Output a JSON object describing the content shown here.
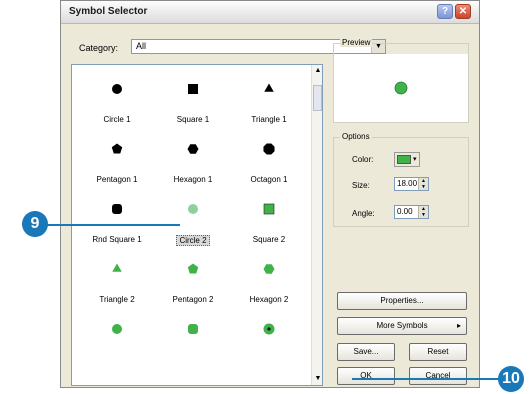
{
  "window": {
    "title": "Symbol Selector"
  },
  "title_buttons": {
    "help": "?",
    "close": "✕"
  },
  "category": {
    "label": "Category:",
    "value": "All"
  },
  "symbols": [
    {
      "label": "Circle 1",
      "shape": "circle",
      "color": "#000000",
      "selected": false
    },
    {
      "label": "Square 1",
      "shape": "square",
      "color": "#000000",
      "selected": false
    },
    {
      "label": "Triangle 1",
      "shape": "triangle",
      "color": "#000000",
      "selected": false
    },
    {
      "label": "Pentagon 1",
      "shape": "pentagon",
      "color": "#000000",
      "selected": false
    },
    {
      "label": "Hexagon 1",
      "shape": "hexagon",
      "color": "#000000",
      "selected": false
    },
    {
      "label": "Octagon 1",
      "shape": "octagon",
      "color": "#000000",
      "selected": false
    },
    {
      "label": "Rnd Square 1",
      "shape": "rounded-square",
      "color": "#000000",
      "selected": false
    },
    {
      "label": "Circle 2",
      "shape": "circle",
      "color": "#8fd19a",
      "selected": true
    },
    {
      "label": "Square 2",
      "shape": "square-outlined",
      "color": "#3fb34a",
      "selected": false
    },
    {
      "label": "Triangle 2",
      "shape": "triangle",
      "color": "#3fb34a",
      "selected": false
    },
    {
      "label": "Pentagon 2",
      "shape": "pentagon",
      "color": "#3fb34a",
      "selected": false
    },
    {
      "label": "Hexagon 2",
      "shape": "hexagon",
      "color": "#3fb34a",
      "selected": false
    },
    {
      "label": "",
      "shape": "circle",
      "color": "#3fb34a",
      "selected": false
    },
    {
      "label": "",
      "shape": "rounded-square",
      "color": "#3fb34a",
      "selected": false
    },
    {
      "label": "",
      "shape": "circle-dot",
      "color": "#3fb34a",
      "selected": false
    }
  ],
  "preview": {
    "label": "Preview",
    "symbol_color": "#3fb34a"
  },
  "options": {
    "label": "Options",
    "color_label": "Color:",
    "color_value": "#3fb34a",
    "size_label": "Size:",
    "size_value": "18.00",
    "angle_label": "Angle:",
    "angle_value": "0.00"
  },
  "buttons": {
    "properties": "Properties...",
    "more_symbols": "More Symbols",
    "save": "Save...",
    "reset": "Reset",
    "ok": "OK",
    "cancel": "Cancel"
  },
  "callouts": {
    "step_9": "9",
    "step_10": "10"
  },
  "colors": {
    "callout": "#1878b8",
    "accent_green": "#3fb34a"
  }
}
